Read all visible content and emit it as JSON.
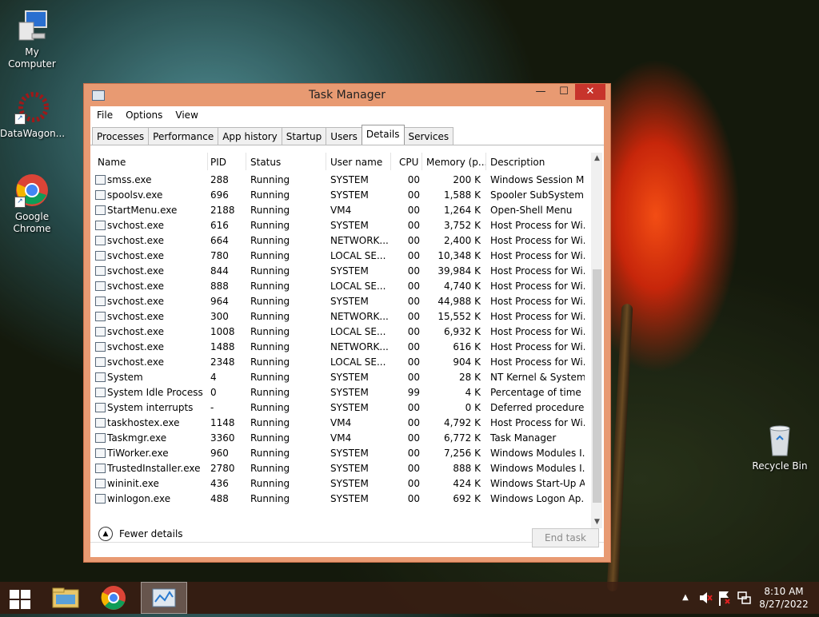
{
  "desktop": {
    "icons": [
      {
        "label": "My Computer"
      },
      {
        "label": "DataWagon..."
      },
      {
        "label": "Google Chrome"
      },
      {
        "label": "Recycle Bin"
      }
    ]
  },
  "window": {
    "title": "Task Manager",
    "menu": [
      "File",
      "Options",
      "View"
    ],
    "tabs": [
      "Processes",
      "Performance",
      "App history",
      "Startup",
      "Users",
      "Details",
      "Services"
    ],
    "active_tab": "Details",
    "columns": [
      "Name",
      "PID",
      "Status",
      "User name",
      "CPU",
      "Memory (p...",
      "Description"
    ],
    "rows": [
      [
        "smss.exe",
        "288",
        "Running",
        "SYSTEM",
        "00",
        "200 K",
        "Windows Session M..."
      ],
      [
        "spoolsv.exe",
        "696",
        "Running",
        "SYSTEM",
        "00",
        "1,588 K",
        "Spooler SubSystem ..."
      ],
      [
        "StartMenu.exe",
        "2188",
        "Running",
        "VM4",
        "00",
        "1,264 K",
        "Open-Shell Menu"
      ],
      [
        "svchost.exe",
        "616",
        "Running",
        "SYSTEM",
        "00",
        "3,752 K",
        "Host Process for Wi..."
      ],
      [
        "svchost.exe",
        "664",
        "Running",
        "NETWORK...",
        "00",
        "2,400 K",
        "Host Process for Wi..."
      ],
      [
        "svchost.exe",
        "780",
        "Running",
        "LOCAL SE...",
        "00",
        "10,348 K",
        "Host Process for Wi..."
      ],
      [
        "svchost.exe",
        "844",
        "Running",
        "SYSTEM",
        "00",
        "39,984 K",
        "Host Process for Wi..."
      ],
      [
        "svchost.exe",
        "888",
        "Running",
        "LOCAL SE...",
        "00",
        "4,740 K",
        "Host Process for Wi..."
      ],
      [
        "svchost.exe",
        "964",
        "Running",
        "SYSTEM",
        "00",
        "44,988 K",
        "Host Process for Wi..."
      ],
      [
        "svchost.exe",
        "300",
        "Running",
        "NETWORK...",
        "00",
        "15,552 K",
        "Host Process for Wi..."
      ],
      [
        "svchost.exe",
        "1008",
        "Running",
        "LOCAL SE...",
        "00",
        "6,932 K",
        "Host Process for Wi..."
      ],
      [
        "svchost.exe",
        "1488",
        "Running",
        "NETWORK...",
        "00",
        "616 K",
        "Host Process for Wi..."
      ],
      [
        "svchost.exe",
        "2348",
        "Running",
        "LOCAL SE...",
        "00",
        "904 K",
        "Host Process for Wi..."
      ],
      [
        "System",
        "4",
        "Running",
        "SYSTEM",
        "00",
        "28 K",
        "NT Kernel & System"
      ],
      [
        "System Idle Process",
        "0",
        "Running",
        "SYSTEM",
        "99",
        "4 K",
        "Percentage of time t..."
      ],
      [
        "System interrupts",
        "-",
        "Running",
        "SYSTEM",
        "00",
        "0 K",
        "Deferred procedure ..."
      ],
      [
        "taskhostex.exe",
        "1148",
        "Running",
        "VM4",
        "00",
        "4,792 K",
        "Host Process for Wi..."
      ],
      [
        "Taskmgr.exe",
        "3360",
        "Running",
        "VM4",
        "00",
        "6,772 K",
        "Task Manager"
      ],
      [
        "TiWorker.exe",
        "960",
        "Running",
        "SYSTEM",
        "00",
        "7,256 K",
        "Windows Modules I..."
      ],
      [
        "TrustedInstaller.exe",
        "2780",
        "Running",
        "SYSTEM",
        "00",
        "888 K",
        "Windows Modules I..."
      ],
      [
        "wininit.exe",
        "436",
        "Running",
        "SYSTEM",
        "00",
        "424 K",
        "Windows Start-Up A..."
      ],
      [
        "winlogon.exe",
        "488",
        "Running",
        "SYSTEM",
        "00",
        "692 K",
        "Windows Logon Ap..."
      ]
    ],
    "fewer_details": "Fewer details",
    "end_task": "End task"
  },
  "taskbar": {
    "time": "8:10 AM",
    "date": "8/27/2022"
  }
}
